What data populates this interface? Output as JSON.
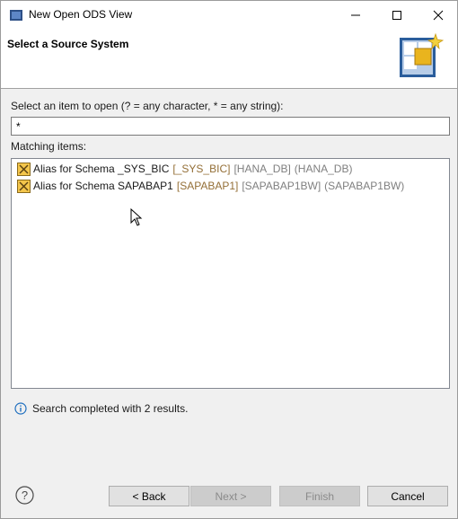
{
  "window": {
    "title": "New Open ODS View"
  },
  "header": {
    "title": "Select a Source System"
  },
  "form": {
    "prompt": "Select an item to open (? = any character, * = any string):",
    "pattern_value": "*",
    "matching_label": "Matching items:"
  },
  "items": [
    {
      "main": "Alias for Schema _SYS_BIC",
      "q1": "[_SYS_BIC]",
      "q2": "[HANA_DB]",
      "q3": "(HANA_DB)"
    },
    {
      "main": "Alias for Schema SAPABAP1",
      "q1": "[SAPABAP1]",
      "q2": "[SAPABAP1BW]",
      "q3": "(SAPABAP1BW)"
    }
  ],
  "status": {
    "text": "Search completed with 2 results."
  },
  "buttons": {
    "back": "< Back",
    "next": "Next >",
    "finish": "Finish",
    "cancel": "Cancel"
  },
  "colors": {
    "accent_gold": "#946f37",
    "info_blue": "#1f6fbf"
  }
}
